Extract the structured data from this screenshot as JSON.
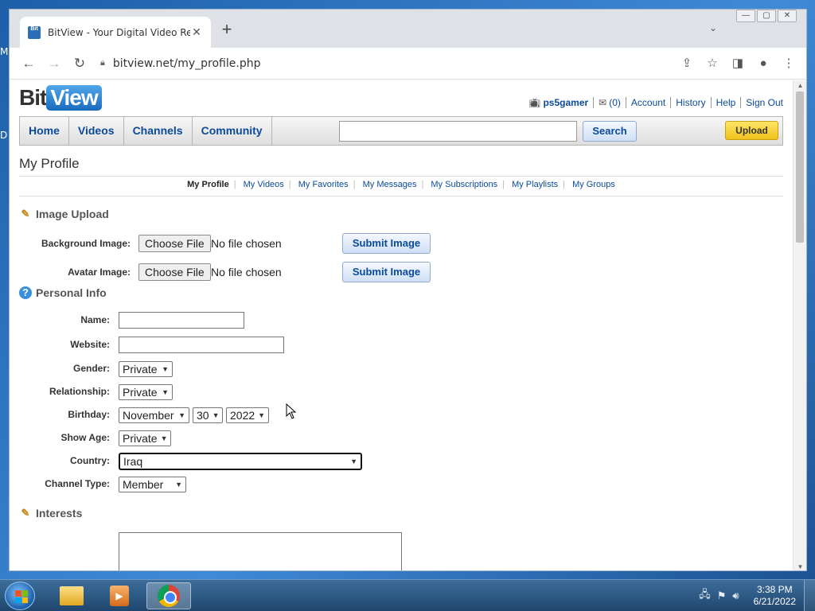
{
  "desktop": {
    "side_letters": [
      "M",
      "D"
    ]
  },
  "browser": {
    "tab_title": "BitView - Your Digital Video Repo",
    "favicon_text": "Bit",
    "url": "bitview.net/my_profile.php"
  },
  "site": {
    "logo_bit": "Bit",
    "logo_view": "View",
    "username": "ps5gamer",
    "messages_count": "(0)",
    "links": [
      "Account",
      "History",
      "Help",
      "Sign Out"
    ],
    "nav": [
      "Home",
      "Videos",
      "Channels",
      "Community"
    ],
    "search_button": "Search",
    "upload_button": "Upload"
  },
  "page": {
    "title": "My Profile",
    "subnav_active": "My Profile",
    "subnav": [
      "My Videos",
      "My Favorites",
      "My Messages",
      "My Subscriptions",
      "My Playlists",
      "My Groups"
    ]
  },
  "image_upload": {
    "heading": "Image Upload",
    "background_label": "Background Image:",
    "avatar_label": "Avatar Image:",
    "choose_file": "Choose File",
    "no_file": "No file chosen",
    "submit": "Submit Image"
  },
  "personal_info": {
    "heading": "Personal Info",
    "name_label": "Name:",
    "website_label": "Website:",
    "gender_label": "Gender:",
    "gender_value": "Private",
    "relationship_label": "Relationship:",
    "relationship_value": "Private",
    "birthday_label": "Birthday:",
    "birthday_month": "November",
    "birthday_day": "30",
    "birthday_year": "2022",
    "show_age_label": "Show Age:",
    "show_age_value": "Private",
    "country_label": "Country:",
    "country_value": "Iraq",
    "channel_type_label": "Channel Type:",
    "channel_type_value": "Member"
  },
  "interests": {
    "heading": "Interests"
  },
  "taskbar": {
    "time": "3:38 PM",
    "date": "6/21/2022"
  }
}
